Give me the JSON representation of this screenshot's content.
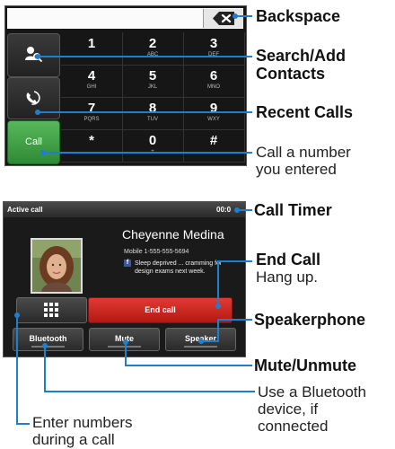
{
  "dialer": {
    "call_button": "Call",
    "keys": [
      {
        "digit": "1",
        "letters": ""
      },
      {
        "digit": "2",
        "letters": "ABC"
      },
      {
        "digit": "3",
        "letters": "DEF"
      },
      {
        "digit": "4",
        "letters": "GHI"
      },
      {
        "digit": "5",
        "letters": "JKL"
      },
      {
        "digit": "6",
        "letters": "MNO"
      },
      {
        "digit": "7",
        "letters": "PQRS"
      },
      {
        "digit": "8",
        "letters": "TUV"
      },
      {
        "digit": "9",
        "letters": "WXY"
      },
      {
        "digit": "*",
        "letters": ""
      },
      {
        "digit": "0",
        "letters": "+"
      },
      {
        "digit": "#",
        "letters": ""
      }
    ]
  },
  "incall": {
    "title": "Active call",
    "timer": "00:0",
    "contact_name": "Cheyenne Medina",
    "contact_number": "Mobile 1-555-555-5694",
    "status_line1": "Sleep deprived ... cramming for",
    "status_line2": "design exams next week.",
    "end_call": "End call",
    "bluetooth": "Bluetooth",
    "mute": "Mute",
    "speaker": "Speaker"
  },
  "callouts": {
    "backspace": "Backspace",
    "search_add_1": "Search/Add",
    "search_add_2": "Contacts",
    "recent_calls": "Recent Calls",
    "call_number_1": "Call a number",
    "call_number_2": "you entered",
    "call_timer": "Call Timer",
    "end_call_title": "End Call",
    "end_call_desc": "Hang up.",
    "speakerphone": "Speakerphone",
    "mute_unmute": "Mute/Unmute",
    "bluetooth_1": "Use a Bluetooth",
    "bluetooth_2": "device, if",
    "bluetooth_3": "connected",
    "enter_numbers_1": "Enter numbers",
    "enter_numbers_2": "during a call"
  },
  "colors": {
    "callout_line": "#1e7fd1",
    "call_green": "#3f9e42",
    "end_call_red": "#c9231c"
  }
}
